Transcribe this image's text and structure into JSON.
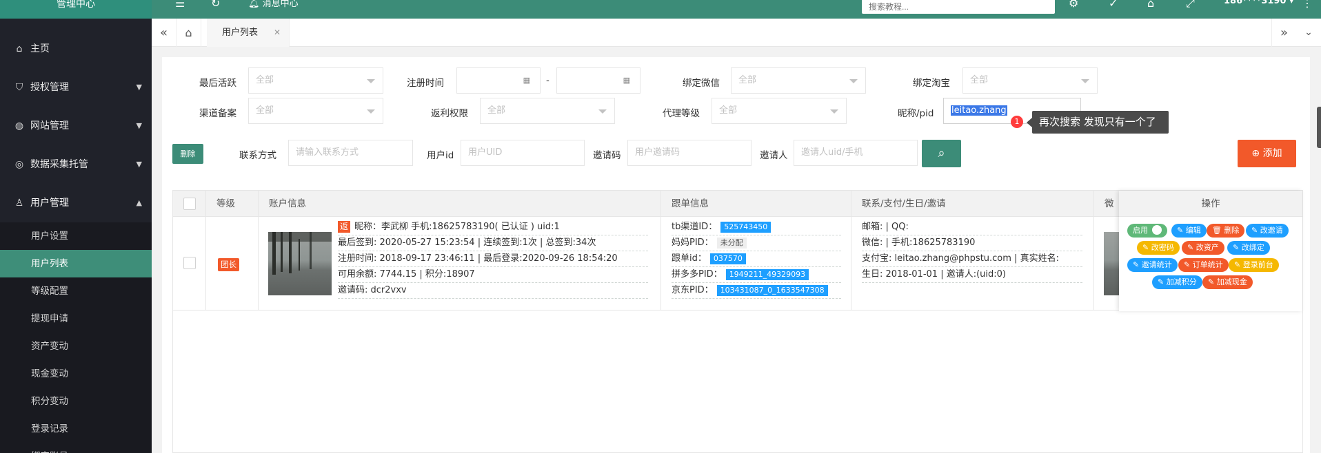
{
  "sidebar": {
    "logo": "管理中心",
    "menu": [
      {
        "label": "主页",
        "icon": "home-icon"
      },
      {
        "label": "授权管理",
        "icon": "shield-icon"
      },
      {
        "label": "网站管理",
        "icon": "globe-icon"
      },
      {
        "label": "数据采集托管",
        "icon": "target-icon"
      },
      {
        "label": "用户管理",
        "icon": "user-icon"
      }
    ],
    "submenu": [
      "用户设置",
      "用户列表",
      "等级配置",
      "提现申请",
      "资产变动",
      "现金变动",
      "积分变动",
      "登录记录",
      "绑定账号"
    ]
  },
  "topbar": {
    "message_center": "消息中心",
    "search_placeholder": "搜索教程...",
    "user_phone": "186****3190"
  },
  "tabs": {
    "active": "用户列表"
  },
  "filters": {
    "last_active": {
      "label": "最后活跃",
      "value": "全部"
    },
    "register_time": {
      "label": "注册时间",
      "separator": "-"
    },
    "bind_wechat": {
      "label": "绑定微信",
      "value": "全部"
    },
    "bind_taobao": {
      "label": "绑定淘宝",
      "value": "全部"
    },
    "channel": {
      "label": "渠道备案",
      "value": "全部"
    },
    "rebate": {
      "label": "返利权限",
      "value": "全部"
    },
    "agent_level": {
      "label": "代理等级",
      "value": "全部"
    },
    "nickname_pid": {
      "label": "昵称/pid",
      "value": "leitao.zhang"
    },
    "contact": {
      "label": "联系方式",
      "placeholder": "请输入联系方式"
    },
    "user_id": {
      "label": "用户id",
      "placeholder": "用户UID"
    },
    "invite_code": {
      "label": "邀请码",
      "placeholder": "用户邀请码"
    },
    "inviter": {
      "label": "邀请人",
      "placeholder": "邀请人uid/手机"
    }
  },
  "annotation": {
    "number": "1",
    "text": "再次搜索 发现只有一个了"
  },
  "buttons": {
    "delete": "删除",
    "add": "添加"
  },
  "table": {
    "headers": [
      "等级",
      "账户信息",
      "跟单信息",
      "联系/支付/生日/邀请",
      "微",
      "操作"
    ],
    "row": {
      "level": "团长",
      "account": {
        "badge": "返",
        "line1": "昵称：李武柳  手机:18625783190( 已认证 )   uid:1",
        "line2": "最后签到: 2020-05-27 15:23:54  |  连续签到:1次  |  总签到:34次",
        "line3": "注册时间: 2018-09-17 23:46:11  |  最后登录:2020-09-26 18:54:20",
        "line4": "可用余额: 7744.15  |  积分:18907",
        "line5": "邀请码: dcr2vxv"
      },
      "tracking": [
        {
          "label": "tb渠道ID：",
          "value": "525743450",
          "style": "blue"
        },
        {
          "label": "妈妈PID：",
          "value": "未分配",
          "style": "grey"
        },
        {
          "label": "跟单id：",
          "value": "037570",
          "style": "blue"
        },
        {
          "label": "拼多多PID：",
          "value": "1949211_49329093",
          "style": "blue"
        },
        {
          "label": "京东PID：",
          "value": "103431087_0_1633547308",
          "style": "blue"
        }
      ],
      "contact": {
        "line1": "邮箱:  |  QQ:",
        "line2": "微信:  |  手机:18625783190",
        "line3": "支付宝: leitao.zhang@phpstu.com  |  真实姓名:",
        "line4": "生日: 2018-01-01  |  邀请人:(uid:0)"
      },
      "actions": [
        {
          "label": "启用",
          "color": "green"
        },
        {
          "label": "编辑",
          "color": "blue"
        },
        {
          "label": "删除",
          "color": "red"
        },
        {
          "label": "改邀请",
          "color": "blue"
        },
        {
          "label": "改密码",
          "color": "yellow"
        },
        {
          "label": "改资产",
          "color": "red"
        },
        {
          "label": "改绑定",
          "color": "blue"
        },
        {
          "label": "邀请统计",
          "color": "blue"
        },
        {
          "label": "订单统计",
          "color": "red"
        },
        {
          "label": "登录前台",
          "color": "yellow"
        },
        {
          "label": "加减积分",
          "color": "blue"
        },
        {
          "label": "加减现金",
          "color": "red"
        }
      ]
    }
  }
}
